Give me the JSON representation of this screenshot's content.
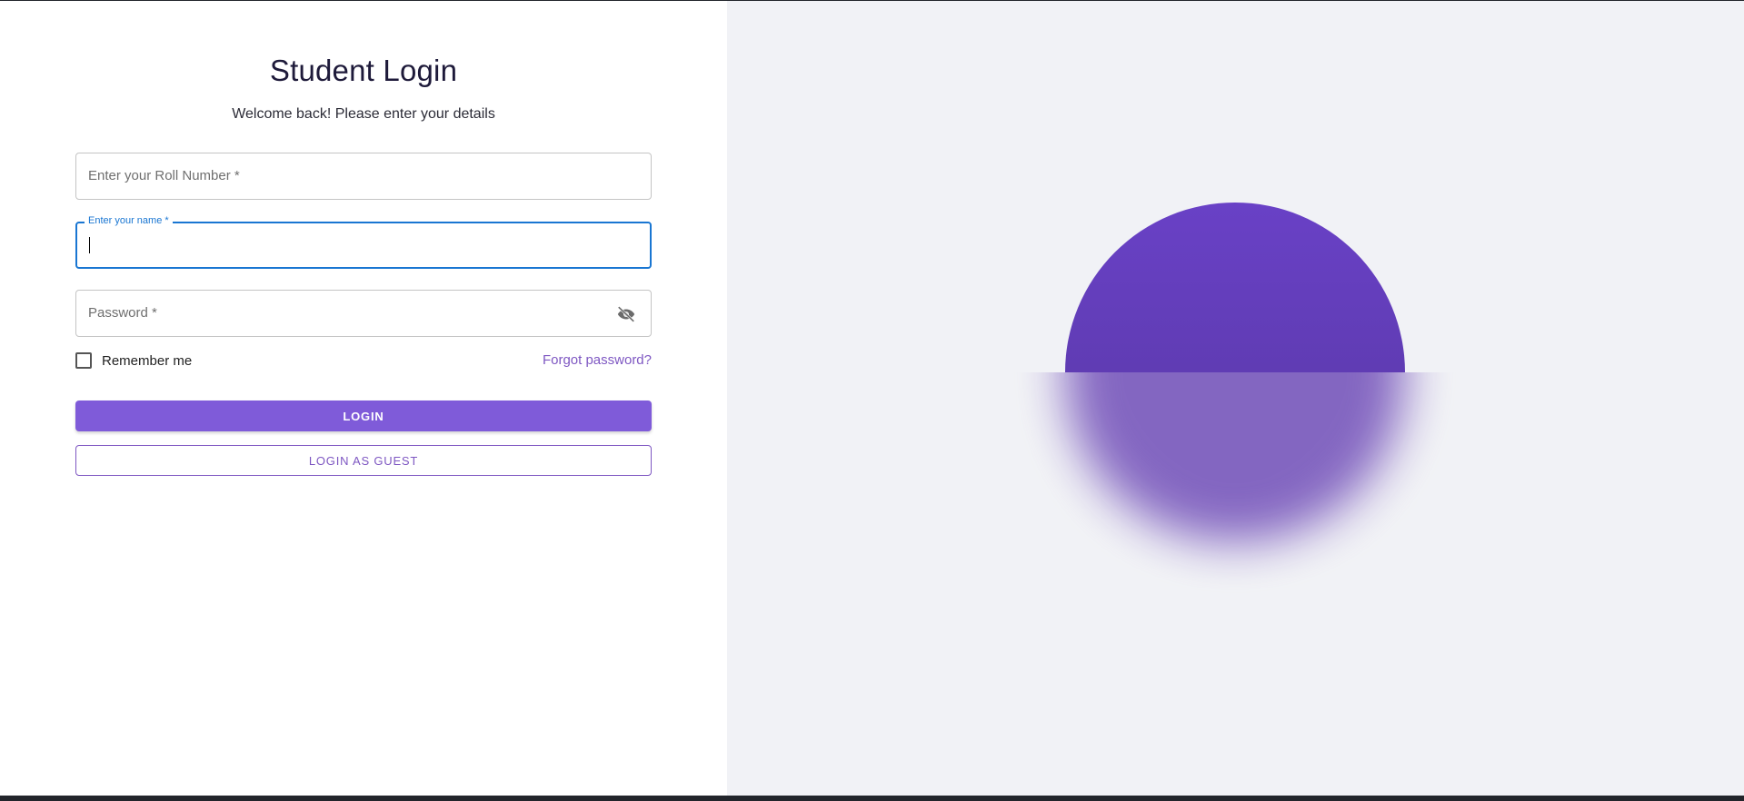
{
  "login": {
    "title": "Student Login",
    "subtitle": "Welcome back! Please enter your details",
    "roll_placeholder": "Enter your Roll Number *",
    "name_label": "Enter your name *",
    "name_value": "",
    "password_placeholder": "Password *",
    "password_toggle_icon": "eye-off-icon",
    "remember_label": "Remember me",
    "remember_checked": false,
    "forgot_label": "Forgot password?",
    "login_button": "LOGIN",
    "guest_button": "LOGIN AS GUEST"
  },
  "colors": {
    "accent": "#7e57c2",
    "primary_button": "#7f5bd9",
    "focus": "#1976d2",
    "circle": "#6941c6",
    "right_panel_bg": "#f1f2f6"
  }
}
